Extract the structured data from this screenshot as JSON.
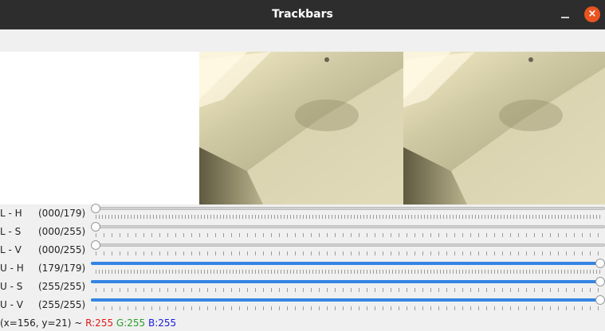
{
  "window": {
    "title": "Trackbars",
    "minimize_icon": "minimize-icon",
    "close_icon": "close-icon",
    "close_color": "#e95420"
  },
  "trackbars": [
    {
      "label": "L - H",
      "value_text": "(000/179)",
      "value": 0,
      "max": 179
    },
    {
      "label": "L - S",
      "value_text": "(000/255)",
      "value": 0,
      "max": 255
    },
    {
      "label": "L - V",
      "value_text": "(000/255)",
      "value": 0,
      "max": 255
    },
    {
      "label": "U - H",
      "value_text": "(179/179)",
      "value": 179,
      "max": 179
    },
    {
      "label": "U - S",
      "value_text": "(255/255)",
      "value": 255,
      "max": 255
    },
    {
      "label": "U - V",
      "value_text": "(255/255)",
      "value": 255,
      "max": 255
    }
  ],
  "status": {
    "coords": "(x=156, y=21) ~ ",
    "r": "R:255",
    "g": "G:255",
    "b": "B:255"
  }
}
